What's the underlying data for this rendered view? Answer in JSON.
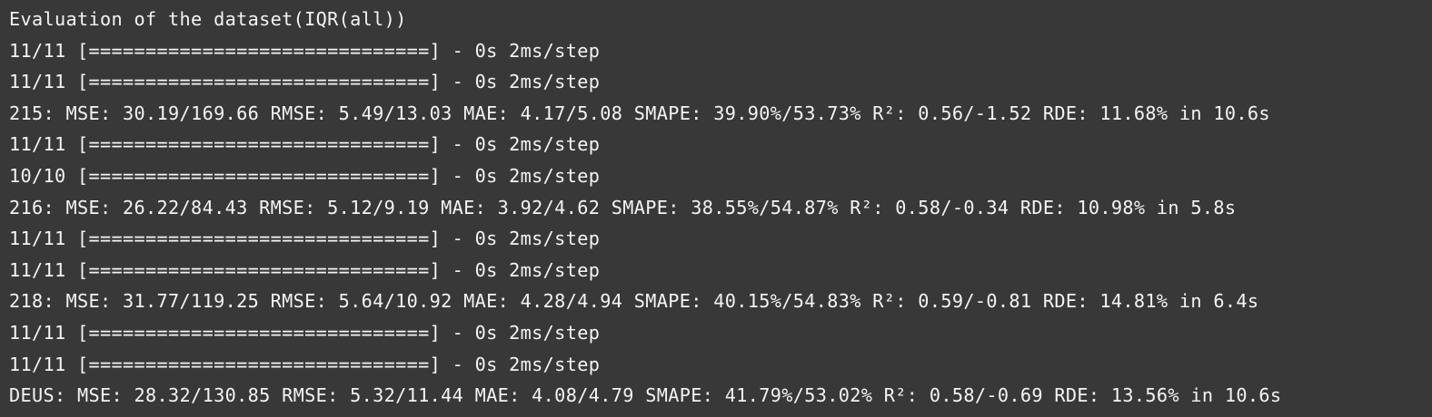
{
  "terminal": {
    "lines": [
      "Evaluation of the dataset(IQR(all))",
      "11/11 [==============================] - 0s 2ms/step",
      "11/11 [==============================] - 0s 2ms/step",
      "215: MSE: 30.19/169.66 RMSE: 5.49/13.03 MAE: 4.17/5.08 SMAPE: 39.90%/53.73% R²: 0.56/-1.52 RDE: 11.68% in 10.6s",
      "11/11 [==============================] - 0s 2ms/step",
      "10/10 [==============================] - 0s 2ms/step",
      "216: MSE: 26.22/84.43 RMSE: 5.12/9.19 MAE: 3.92/4.62 SMAPE: 38.55%/54.87% R²: 0.58/-0.34 RDE: 10.98% in 5.8s",
      "11/11 [==============================] - 0s 2ms/step",
      "11/11 [==============================] - 0s 2ms/step",
      "218: MSE: 31.77/119.25 RMSE: 5.64/10.92 MAE: 4.28/4.94 SMAPE: 40.15%/54.83% R²: 0.59/-0.81 RDE: 14.81% in 6.4s",
      "11/11 [==============================] - 0s 2ms/step",
      "11/11 [==============================] - 0s 2ms/step",
      "DEUS: MSE: 28.32/130.85 RMSE: 5.32/11.44 MAE: 4.08/4.79 SMAPE: 41.79%/53.02% R²: 0.58/-0.69 RDE: 13.56% in 10.6s"
    ]
  }
}
